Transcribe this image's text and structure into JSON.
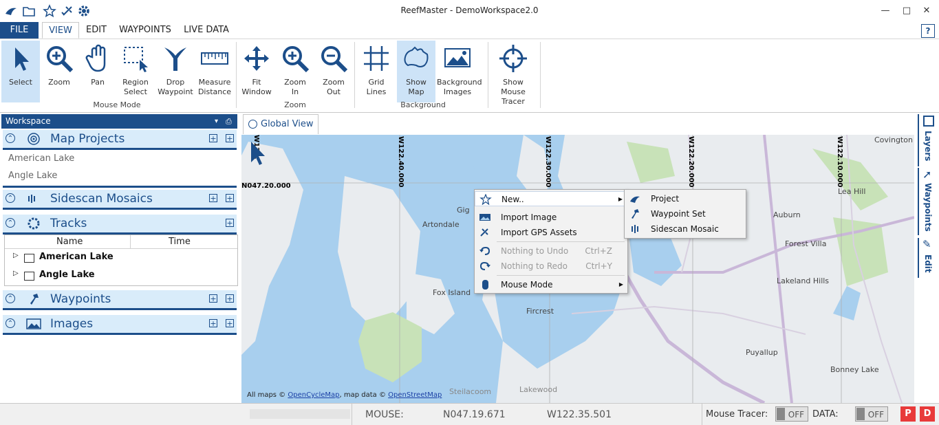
{
  "app": {
    "title": "ReefMaster - DemoWorkspace2.0"
  },
  "menu": {
    "tabs": [
      "FILE",
      "VIEW",
      "EDIT",
      "WAYPOINTS",
      "LIVE DATA"
    ],
    "help": "?"
  },
  "ribbon": {
    "buttons": [
      {
        "label1": "Select",
        "label2": ""
      },
      {
        "label1": "Zoom",
        "label2": ""
      },
      {
        "label1": "Pan",
        "label2": ""
      },
      {
        "label1": "Region",
        "label2": "Select"
      },
      {
        "label1": "Drop",
        "label2": "Waypoint"
      },
      {
        "label1": "Measure",
        "label2": "Distance"
      },
      {
        "label1": "Fit",
        "label2": "Window"
      },
      {
        "label1": "Zoom",
        "label2": "In"
      },
      {
        "label1": "Zoom",
        "label2": "Out"
      },
      {
        "label1": "Grid",
        "label2": "Lines"
      },
      {
        "label1": "Show",
        "label2": "Map"
      },
      {
        "label1": "Background",
        "label2": "Images"
      },
      {
        "label1": "Show Mouse",
        "label2": "Tracer"
      }
    ],
    "groups": {
      "mouse_mode": "Mouse Mode",
      "zoom": "Zoom",
      "background": "Background"
    }
  },
  "workspace": {
    "title": "Workspace",
    "pin": "▾  ⊥",
    "sections": {
      "map_projects": "Map Projects",
      "sidescan": "Sidescan Mosaics",
      "tracks": "Tracks",
      "waypoints": "Waypoints",
      "images": "Images"
    },
    "projects": [
      "American Lake",
      "Angle Lake"
    ],
    "tracks_columns": {
      "name": "Name",
      "time": "Time"
    },
    "tracks_rows": [
      "American Lake",
      "Angle Lake"
    ]
  },
  "map": {
    "tab_label": "Global View",
    "lon_labels": [
      "W122.40.000",
      "W122.30.000",
      "W122.20.000",
      "W122.10.000",
      "W122."
    ],
    "lat_label": "N047.20.000",
    "places": [
      "Gig",
      "Artondale",
      "Fox Island",
      "Fircrest",
      "Auburn",
      "Forest Villa",
      "Lakeland Hills",
      "Lea Hill",
      "Covington",
      "Puyallup",
      "Bonney Lake",
      "Steilacoom",
      "Lakewood"
    ],
    "attribution": {
      "prefix": "All maps © ",
      "link1": "OpenCycleMap",
      "mid": ", map data © ",
      "link2": "OpenStreetMap"
    }
  },
  "context_menu": {
    "items": [
      {
        "label": "New..",
        "shortcut": ""
      },
      {
        "label": "Import Image",
        "shortcut": ""
      },
      {
        "label": "Import GPS Assets",
        "shortcut": ""
      },
      {
        "label": "Nothing to Undo",
        "shortcut": "Ctrl+Z"
      },
      {
        "label": "Nothing to Redo",
        "shortcut": "Ctrl+Y"
      },
      {
        "label": "Mouse Mode",
        "shortcut": ""
      }
    ],
    "submenu": [
      "Project",
      "Waypoint Set",
      "Sidescan Mosaic"
    ]
  },
  "side_tabs": [
    "Layers",
    "Waypoints",
    "Edit"
  ],
  "status": {
    "mouse_label": "MOUSE:",
    "lat": "N047.19.671",
    "lon": "W122.35.501",
    "tracer_label": "Mouse Tracer:",
    "tracer_state": "OFF",
    "data_label": "DATA:",
    "data_state": "OFF",
    "p": "P",
    "d": "D"
  },
  "colors": {
    "accent": "#1c4e8a",
    "water": "#a8cfee",
    "land": "#e9ecef",
    "park": "#c8e2b8",
    "road": "#c9b7d8"
  }
}
